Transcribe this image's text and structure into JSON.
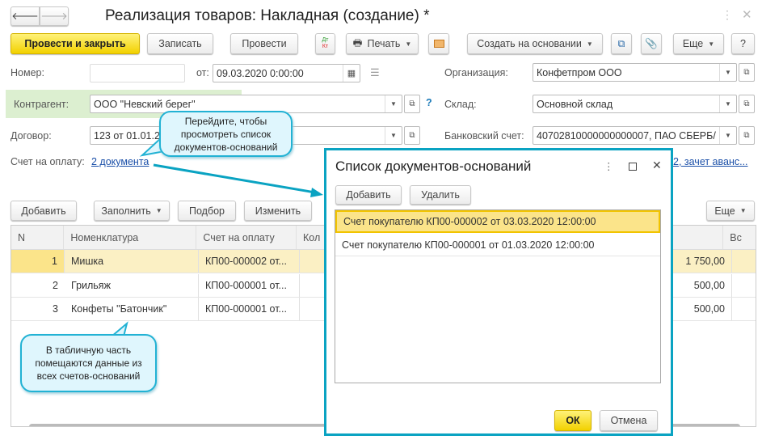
{
  "window": {
    "title": "Реализация товаров: Накладная (создание) *"
  },
  "toolbar": {
    "post_close": "Провести и закрыть",
    "save": "Записать",
    "post": "Провести",
    "dt": "Дт",
    "kt": "Кт",
    "print": "Печать",
    "create_based": "Создать на основании",
    "more": "Еще",
    "help": "?"
  },
  "form": {
    "number_label": "Номер:",
    "number_value": "",
    "from_label": "от:",
    "date_value": "09.03.2020  0:00:00",
    "org_label": "Организация:",
    "org_value": "Конфетпром ООО",
    "contractor_label": "Контрагент:",
    "contractor_value": "ООО \"Невский берег\"",
    "contractor_help": "?",
    "warehouse_label": "Склад:",
    "warehouse_value": "Основной склад",
    "contract_label": "Договор:",
    "contract_value": "123 от 01.01.2",
    "bank_label": "Банковский счет:",
    "bank_value": "40702810000000000007, ПАО СБЕРБ/",
    "invoice_label": "Счет на оплату:",
    "invoice_link": "2 документа",
    "advance_link": "2, зачет аванс..."
  },
  "table_toolbar": {
    "add": "Добавить",
    "fill": "Заполнить",
    "pick": "Подбор",
    "change": "Изменить",
    "more": "Еще"
  },
  "table": {
    "columns": [
      "N",
      "Номенклатура",
      "Счет на оплату",
      "Кол",
      "Вс"
    ],
    "rows": [
      {
        "n": "1",
        "item": "Мишка",
        "invoice": "КП00-000002 от...",
        "sum": "1 750,00"
      },
      {
        "n": "2",
        "item": "Грильяж",
        "invoice": "КП00-000001 от...",
        "sum": "500,00"
      },
      {
        "n": "3",
        "item": "Конфеты \"Батончик\"",
        "invoice": "КП00-000001 от...",
        "sum": "500,00"
      }
    ]
  },
  "callouts": {
    "top": "Перейдите, чтобы просмотреть список документов-оснований",
    "bottom": "В табличную часть помещаются данные из всех счетов-оснований"
  },
  "dialog": {
    "title": "Список документов-оснований",
    "add": "Добавить",
    "delete": "Удалить",
    "items": [
      "Счет покупателю КП00-000002 от 03.03.2020 12:00:00",
      "Счет покупателю КП00-000001 от 01.03.2020 12:00:00"
    ],
    "ok": "ОК",
    "cancel": "Отмена"
  },
  "colors": {
    "accent": "#0aa3c2",
    "yellow": "#f2d100",
    "selection": "#fbe48a"
  }
}
